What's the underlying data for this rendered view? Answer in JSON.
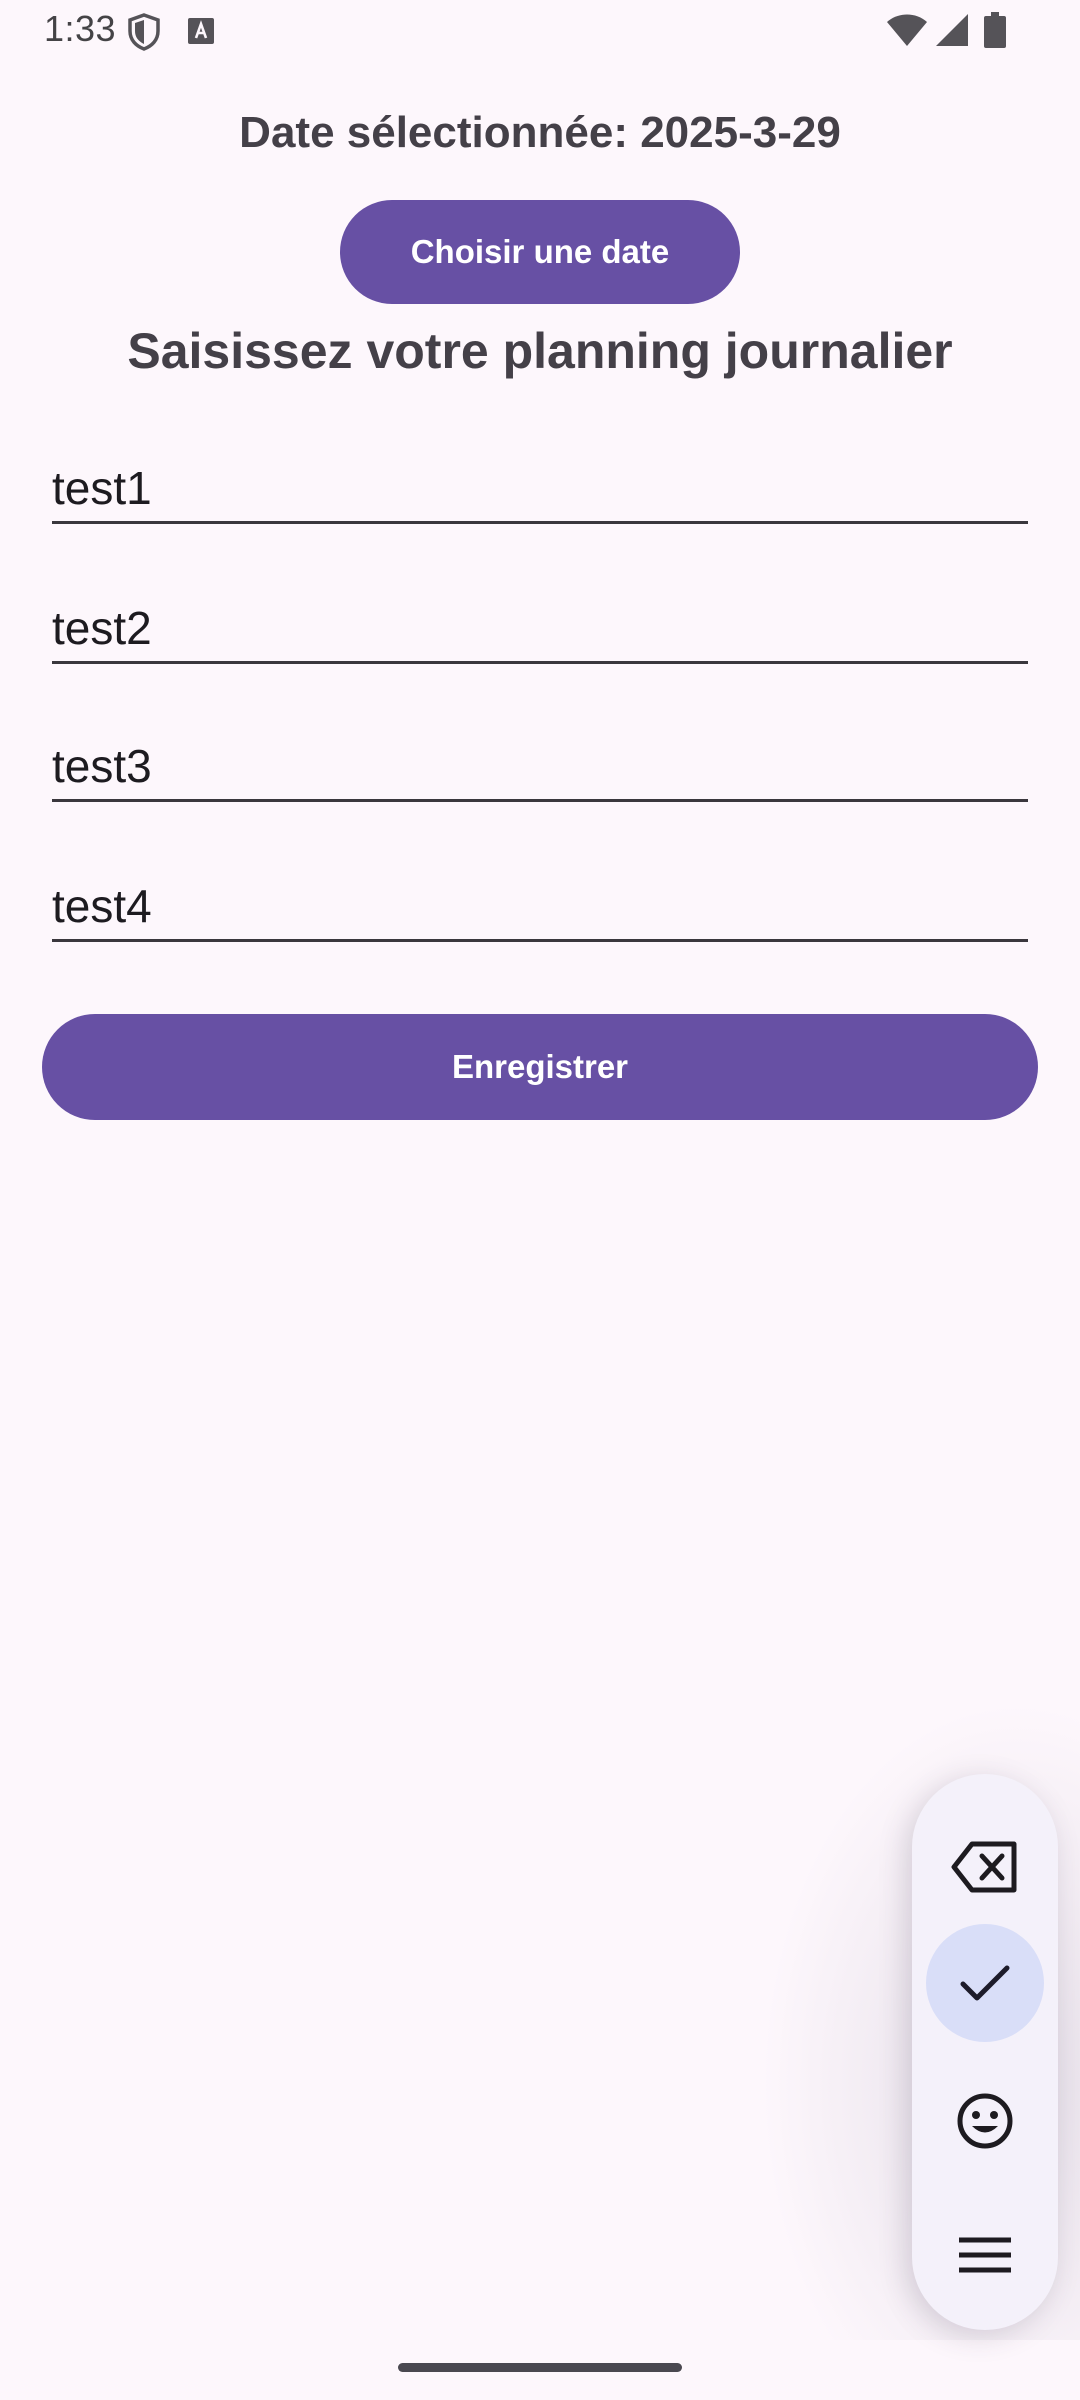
{
  "status_bar": {
    "time": "1:33",
    "icons": [
      "shield-icon",
      "keyboard-a-icon",
      "wifi-icon",
      "signal-icon",
      "battery-icon"
    ]
  },
  "main": {
    "selected_date_label": "Date sélectionnée: 2025-3-29",
    "pick_date_button": "Choisir une date",
    "heading": "Saisissez votre planning journalier",
    "fields": [
      {
        "value": "test1"
      },
      {
        "value": "test2"
      },
      {
        "value": "test3"
      },
      {
        "value": "test4"
      }
    ],
    "save_button": "Enregistrer"
  },
  "keyboard_toolbar": {
    "buttons": [
      "backspace-icon",
      "check-icon",
      "emoji-icon",
      "menu-icon"
    ],
    "active": "check-icon"
  },
  "colors": {
    "primary": "#6750A4",
    "background": "#FDF7FC",
    "toolbar_bg": "#F4F1FA",
    "toolbar_active": "#D9DEF8"
  }
}
